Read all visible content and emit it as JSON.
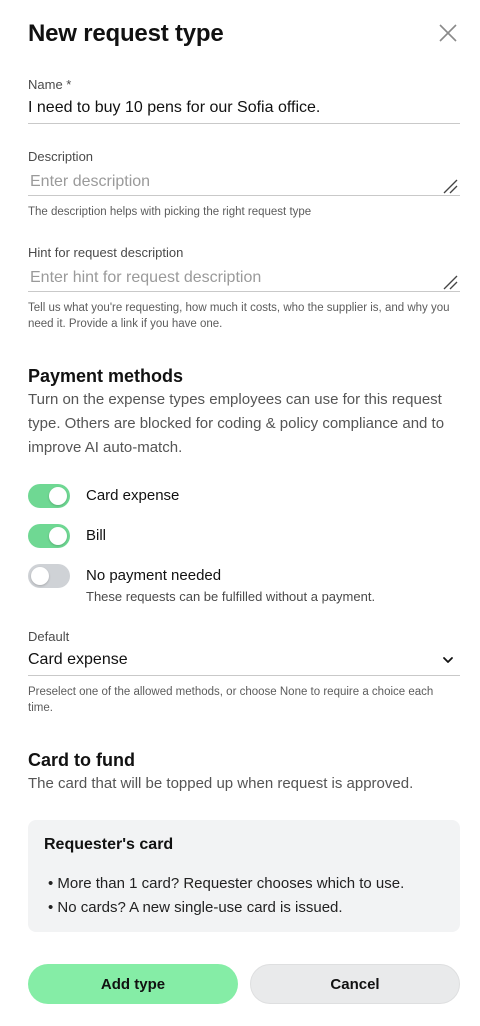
{
  "header": {
    "title": "New request type",
    "close_icon": "close-icon"
  },
  "name_field": {
    "label": "Name *",
    "value": "I need to buy 10 pens for our Sofia office."
  },
  "description_field": {
    "label": "Description",
    "placeholder": "Enter description",
    "help": "The description helps with picking the right request type"
  },
  "hint_field": {
    "label": "Hint for request description",
    "placeholder": "Enter hint for request description",
    "help": "Tell us what you're requesting, how much it costs, who the supplier is, and why you need it. Provide a link if you have one."
  },
  "payment_methods": {
    "title": "Payment methods",
    "description": "Turn on the expense types employees can use for this request type. Others are blocked for coding & policy compliance and to improve AI auto-match.",
    "options": [
      {
        "label": "Card expense",
        "enabled": true,
        "sub": ""
      },
      {
        "label": "Bill",
        "enabled": true,
        "sub": ""
      },
      {
        "label": "No payment needed",
        "enabled": false,
        "sub": "These requests can be fulfilled without a payment."
      }
    ]
  },
  "default_field": {
    "label": "Default",
    "value": "Card expense",
    "help": "Preselect one of the allowed methods, or choose None to require a choice each time."
  },
  "card_to_fund": {
    "title": "Card to fund",
    "description": "The card that will be topped up when request is approved.",
    "box_title": "Requester's card",
    "bullets": [
      "• More than 1 card? Requester chooses which to use.",
      "• No cards? A new single-use card is issued."
    ]
  },
  "actions": {
    "primary_label": "Add type",
    "secondary_label": "Cancel"
  },
  "colors": {
    "toggle_on": "#6fd893",
    "toggle_off": "#cfd2d6",
    "primary_button": "#85eda6"
  }
}
